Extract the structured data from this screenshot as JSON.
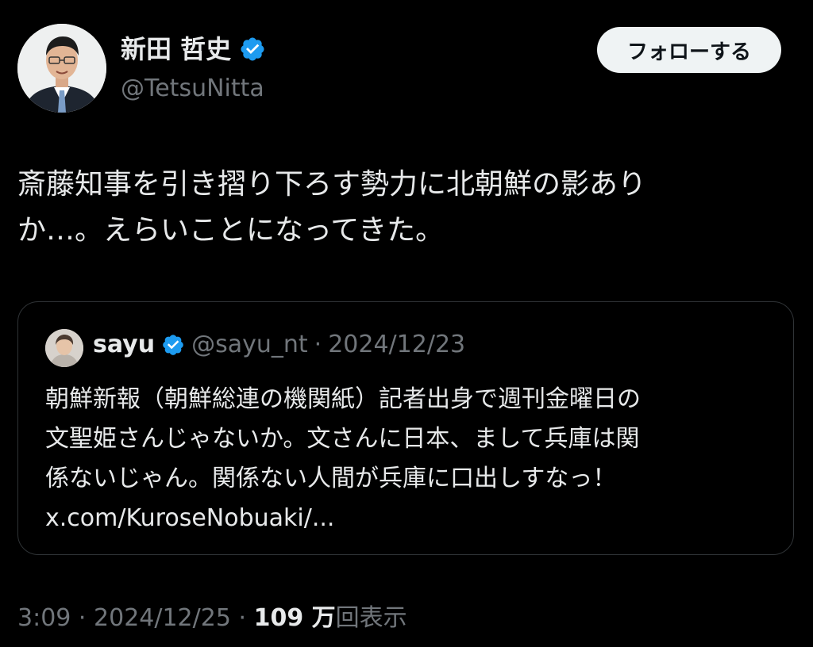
{
  "author": {
    "display_name": "新田 哲史",
    "handle": "@TetsuNitta",
    "verified": true,
    "avatar_icon": "profile-photo"
  },
  "follow_button": {
    "label": "フォローする"
  },
  "tweet": {
    "lines": [
      "斎藤知事を引き摺り下ろす勢力に北朝鮮の影あり",
      "か…。えらいことになってきた。"
    ]
  },
  "quoted": {
    "display_name": "sayu",
    "handle": "@sayu_nt",
    "separator": "·",
    "date": "2024/12/23",
    "verified": true,
    "lines": [
      "朝鮮新報（朝鮮総連の機関紙）記者出身で週刊金曜日の",
      "文聖姫さんじゃないか。文さんに日本、まして兵庫は関",
      "係ないじゃん。関係ない人間が兵庫に口出しすなっ！",
      "x.com/KuroseNobuaki/..."
    ]
  },
  "meta": {
    "time": "3:09",
    "separator": "·",
    "date": "2024/12/25",
    "views_count": "109 万",
    "views_label": "回表示"
  },
  "colors": {
    "background": "#000000",
    "text_primary": "#e7e9ea",
    "text_secondary": "#71767b",
    "verified_blue": "#1d9bf0",
    "border": "#2f3336",
    "follow_bg": "#eff3f4"
  }
}
